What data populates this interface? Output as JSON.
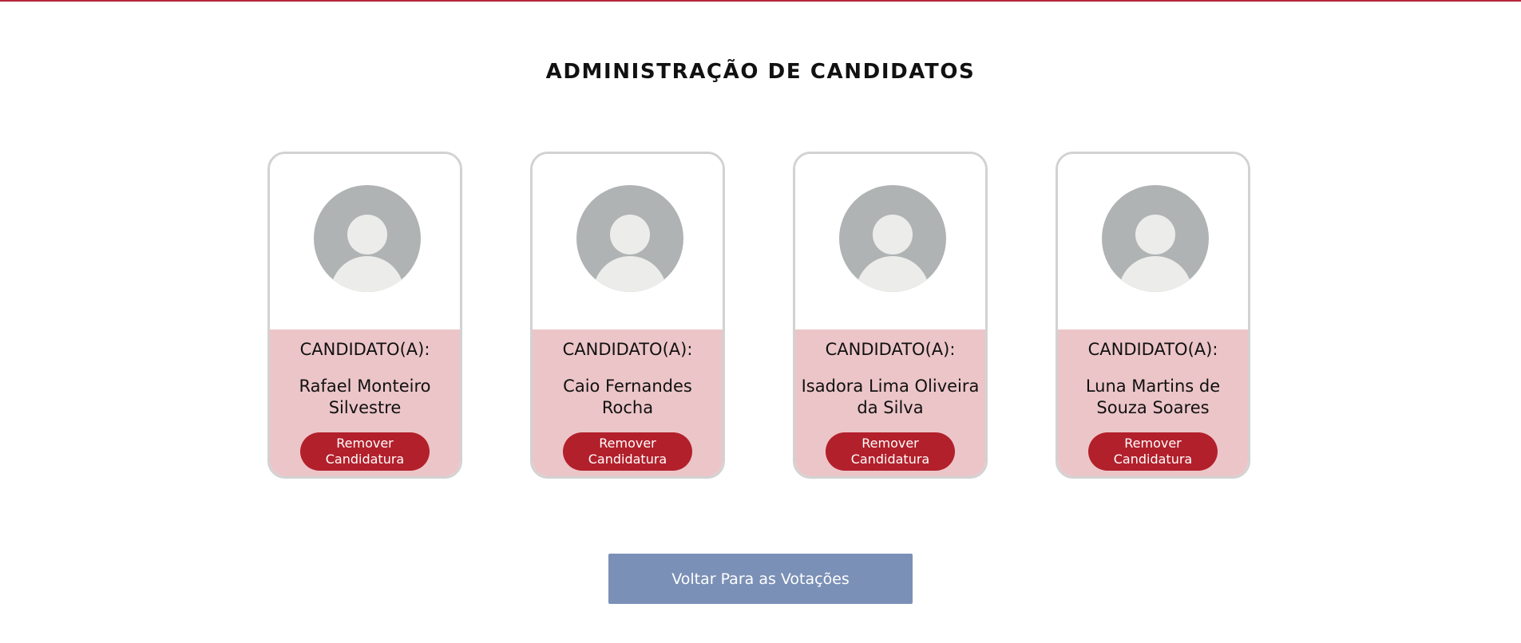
{
  "page": {
    "title": "ADMINISTRAÇÃO DE CANDIDATOS",
    "accent_color": "#b5283a"
  },
  "candidates": [
    {
      "role": "CANDIDATO(A):",
      "name": "Rafael Monteiro Silvestre",
      "remove_line1": "Remover",
      "remove_line2": "Candidatura",
      "avatar_icon": "default-user-avatar-icon"
    },
    {
      "role": "CANDIDATO(A):",
      "name": "Caio Fernandes Rocha",
      "remove_line1": "Remover",
      "remove_line2": "Candidatura",
      "avatar_icon": "default-user-avatar-icon"
    },
    {
      "role": "CANDIDATO(A):",
      "name": "Isadora Lima Oliveira da Silva",
      "remove_line1": "Remover",
      "remove_line2": "Candidatura",
      "avatar_icon": "default-user-avatar-icon"
    },
    {
      "role": "CANDIDATO(A):",
      "name": "Luna Martins de Souza Soares",
      "remove_line1": "Remover",
      "remove_line2": "Candidatura",
      "avatar_icon": "default-user-avatar-icon"
    }
  ],
  "footer": {
    "back_label": "Voltar Para as Votações"
  },
  "colors": {
    "card_body": "#ecc5c8",
    "remove_button": "#b2202b",
    "back_button": "#7b90b6",
    "card_border": "#d2d2d2",
    "avatar_background": "#b0b3b4",
    "avatar_figure": "#ececea"
  }
}
